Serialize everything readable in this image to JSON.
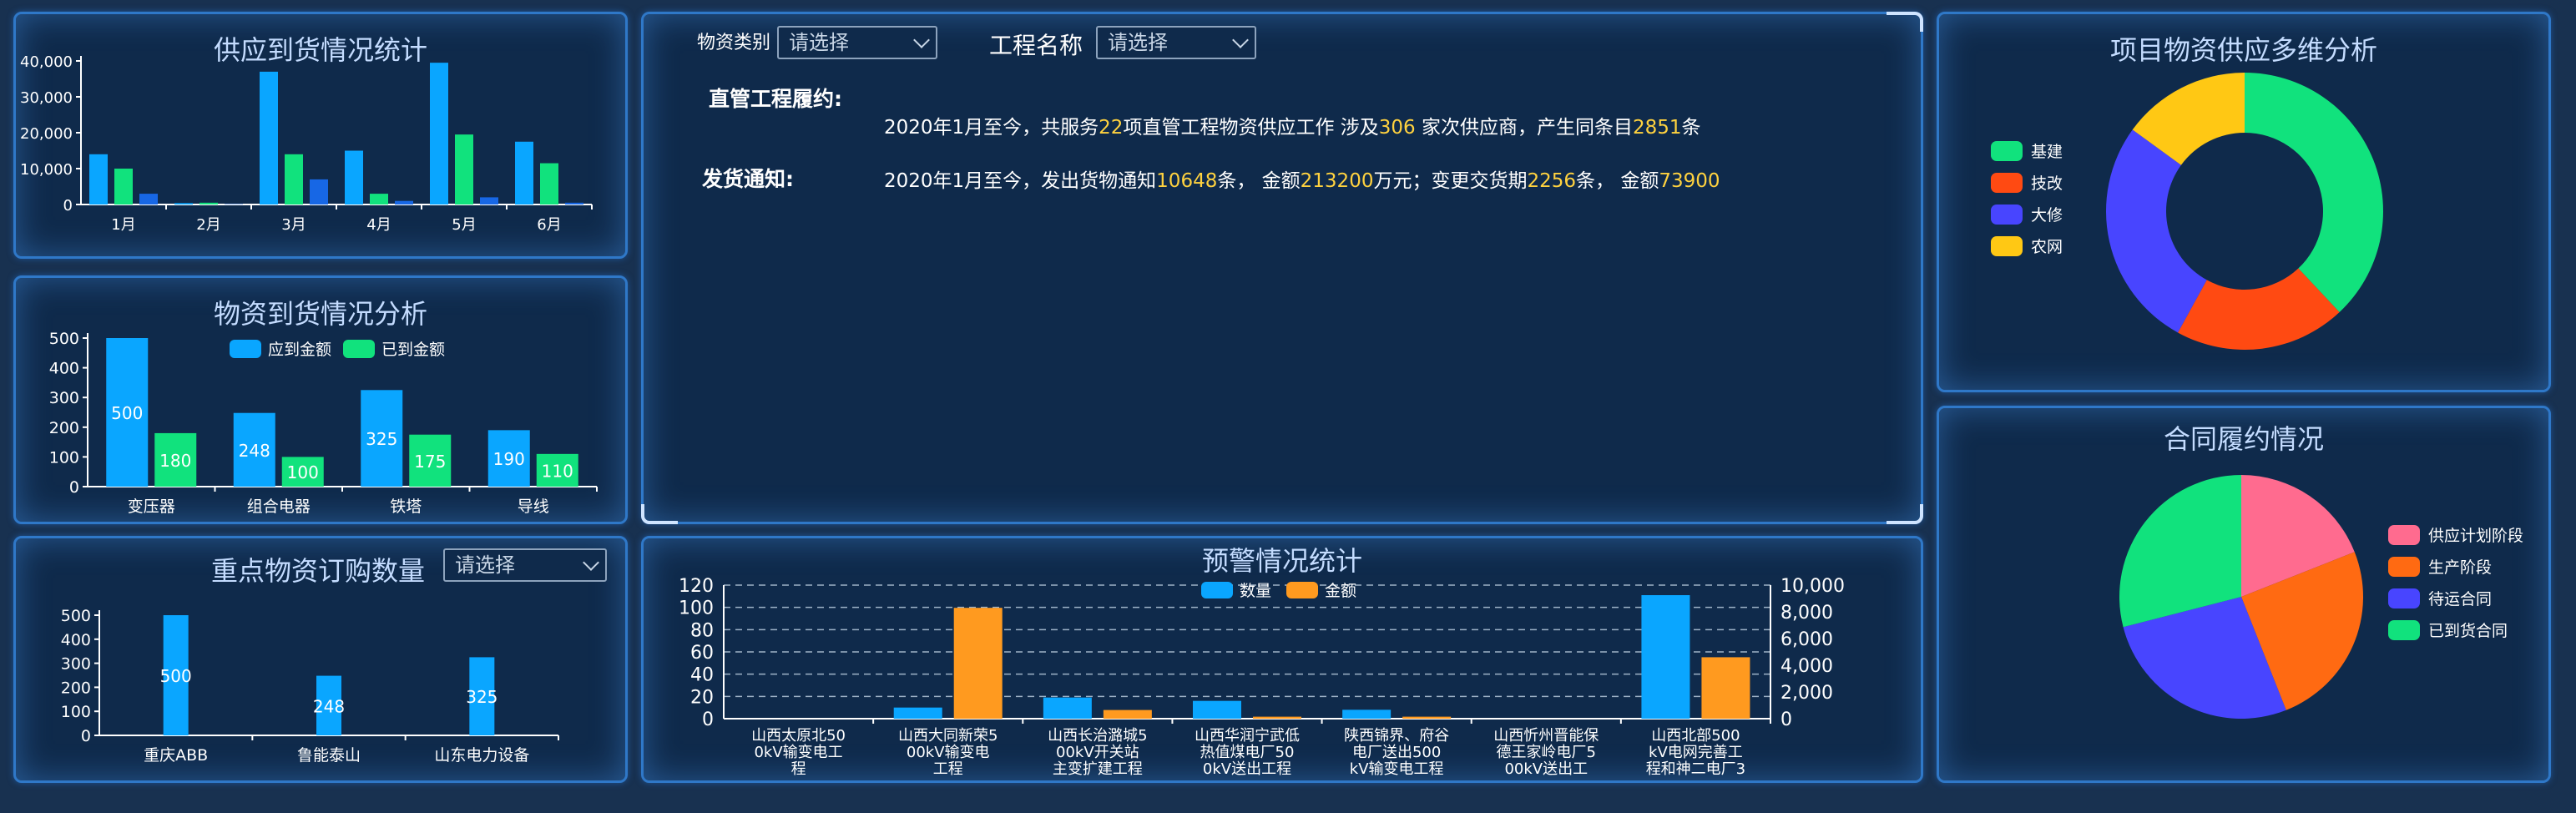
{
  "colors": {
    "blue": "#0aa6ff",
    "green": "#11e27d",
    "darkblue": "#1767e5",
    "orange": "#ff9a1f",
    "axis": "#ffffff"
  },
  "supply": {
    "title": "供应到货情况统计",
    "chart_data": {
      "type": "bar",
      "categories": [
        "1月",
        "2月",
        "3月",
        "4月",
        "5月",
        "6月"
      ],
      "series": [
        {
          "values": [
            14000,
            400,
            37000,
            15000,
            39500,
            17500
          ]
        },
        {
          "values": [
            10000,
            500,
            14000,
            3000,
            19500,
            11500
          ]
        },
        {
          "values": [
            3000,
            100,
            7000,
            1000,
            2000,
            500
          ]
        }
      ],
      "ylim": [
        0,
        40000
      ],
      "yticks": [
        "0",
        "10,000",
        "20,000",
        "30,000",
        "40,000"
      ]
    }
  },
  "arrival": {
    "title": "物资到货情况分析",
    "legend": [
      "应到金额",
      "已到金额"
    ],
    "chart_data": {
      "type": "bar",
      "categories": [
        "变压器",
        "组合电器",
        "铁塔",
        "导线"
      ],
      "series": [
        {
          "name": "应到金额",
          "values": [
            500,
            248,
            325,
            190
          ]
        },
        {
          "name": "已到金额",
          "values": [
            180,
            100,
            175,
            110
          ]
        }
      ],
      "ylim": [
        0,
        500
      ],
      "yticks": [
        "0",
        "100",
        "200",
        "300",
        "400",
        "500"
      ]
    }
  },
  "orders": {
    "title": "重点物资订购数量",
    "select_value": "请选择",
    "chart_data": {
      "type": "bar",
      "categories": [
        "重庆ABB",
        "鲁能泰山",
        "山东电力设备"
      ],
      "series": [
        {
          "values": [
            500,
            248,
            325
          ]
        }
      ],
      "ylim": [
        0,
        500
      ],
      "yticks": [
        "0",
        "100",
        "200",
        "300",
        "400",
        "500"
      ]
    }
  },
  "center": {
    "filter1_label": "物资类别",
    "filter1_value": "请选择",
    "filter2_label": "工程名称",
    "filter2_value": "请选择",
    "row1_head": "直管工程履约:",
    "row1_parts": [
      "2020年1月至今，共服务",
      "22",
      "项直管工程物资供应工作 涉及",
      "306",
      " 家次供应商，产生同条目",
      "2851",
      "条"
    ],
    "row2_head": "发货通知:",
    "row2_parts": [
      "2020年1月至今，发出货物通知",
      "10648",
      "条， 金额",
      "213200",
      "万元；变更交货期",
      "2256",
      "条， 金额",
      "73900"
    ]
  },
  "warning": {
    "title": "预警情况统计",
    "legend": [
      "数量",
      "金额"
    ],
    "chart_data": {
      "type": "bar",
      "categories": [
        [
          "山西太原北50",
          "0kV输变电工",
          "程"
        ],
        [
          "山西大同新荣5",
          "00kV输变电",
          "工程"
        ],
        [
          "山西长治潞城5",
          "00kV开关站",
          "主变扩建工程"
        ],
        [
          "山西华润宁武低",
          "热值煤电厂50",
          "0kV送出工程"
        ],
        [
          "陕西锦界、府谷",
          "电厂送出500",
          "kV输变电工程"
        ],
        [
          "山西忻州晋能保",
          "德王家岭电厂5",
          "00kV送出工"
        ],
        [
          "山西北部500",
          "kV电网完善工",
          "程和神二电厂3"
        ]
      ],
      "series": [
        {
          "name": "数量",
          "values": [
            0,
            10,
            19,
            16,
            8,
            0,
            111
          ]
        },
        {
          "name": "金额",
          "values": [
            0,
            8300,
            650,
            150,
            150,
            0,
            4600
          ]
        }
      ],
      "ylim_left": [
        0,
        120
      ],
      "ylim_right": [
        0,
        10000
      ],
      "yticks_left": [
        "0",
        "20",
        "40",
        "60",
        "80",
        "100",
        "120"
      ],
      "yticks_right": [
        "0",
        "2,000",
        "4,000",
        "6,000",
        "8,000",
        "10,000"
      ]
    }
  },
  "multi": {
    "title": "项目物资供应多维分析",
    "chart_data": {
      "type": "pie",
      "labels": [
        "基建",
        "技改",
        "大修",
        "农网"
      ],
      "values": [
        38,
        20,
        27,
        15
      ],
      "colors": [
        "#11e27d",
        "#ff4a12",
        "#4845ff",
        "#ffc814"
      ]
    }
  },
  "contract": {
    "title": "合同履约情况",
    "chart_data": {
      "type": "pie",
      "labels": [
        "供应计划阶段",
        "生产阶段",
        "待运合同",
        "已到货合同"
      ],
      "values": [
        19,
        25,
        27,
        29
      ],
      "colors": [
        "#ff6b8f",
        "#ff6a12",
        "#4845ff",
        "#11e27d"
      ]
    }
  }
}
